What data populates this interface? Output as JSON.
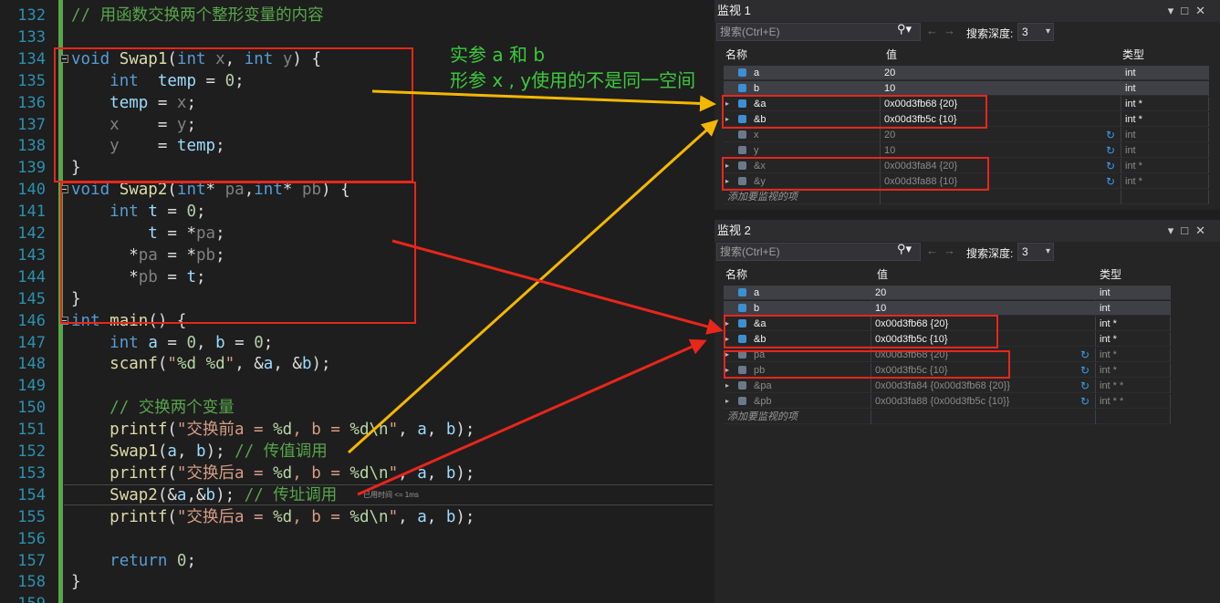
{
  "editor": {
    "lines": [
      {
        "n": "132",
        "t": "// 用函数交换两个整形变量的内容"
      },
      {
        "n": "133",
        "t": ""
      },
      {
        "n": "134",
        "t": "void Swap1(int x, int y) {"
      },
      {
        "n": "135",
        "t": "    int  temp = 0;"
      },
      {
        "n": "136",
        "t": "    temp = x;"
      },
      {
        "n": "137",
        "t": "    x    = y;"
      },
      {
        "n": "138",
        "t": "    y    = temp;"
      },
      {
        "n": "139",
        "t": "}"
      },
      {
        "n": "140",
        "t": "void Swap2(int* pa,int* pb) {"
      },
      {
        "n": "141",
        "t": "    int t = 0;"
      },
      {
        "n": "142",
        "t": "        t = *pa;"
      },
      {
        "n": "143",
        "t": "      *pa = *pb;"
      },
      {
        "n": "144",
        "t": "      *pb = t;"
      },
      {
        "n": "145",
        "t": "}"
      },
      {
        "n": "146",
        "t": "int main() {"
      },
      {
        "n": "147",
        "t": "    int a = 0, b = 0;"
      },
      {
        "n": "148",
        "t": "    scanf(\"%d %d\", &a, &b);"
      },
      {
        "n": "149",
        "t": ""
      },
      {
        "n": "150",
        "t": "    // 交换两个变量"
      },
      {
        "n": "151",
        "t": "    printf(\"交换前a = %d, b = %d\\n\", a, b);"
      },
      {
        "n": "152",
        "t": "    Swap1(a, b); // 传值调用"
      },
      {
        "n": "153",
        "t": "    printf(\"交换后a = %d, b = %d\\n\", a, b);"
      },
      {
        "n": "154",
        "t": "    Swap2(&a,&b); // 传址调用"
      },
      {
        "n": "155",
        "t": "    printf(\"交换后a = %d, b = %d\\n\", a, b);"
      },
      {
        "n": "156",
        "t": ""
      },
      {
        "n": "157",
        "t": "    return 0;"
      },
      {
        "n": "158",
        "t": "}"
      },
      {
        "n": "159",
        "t": ""
      }
    ],
    "perf_tip": "已用时间 <= 1ms"
  },
  "annotation": {
    "line1": "实参 a 和 b",
    "line2": "形参 x , y使用的不是同一空间"
  },
  "watch1": {
    "title": "监视 1",
    "search_placeholder": "搜索(Ctrl+E)",
    "depth_label": "搜索深度:",
    "depth_value": "3",
    "columns": {
      "name": "名称",
      "value": "值",
      "type": "类型"
    },
    "rows": [
      {
        "name": "a",
        "value": "20",
        "type": "int"
      },
      {
        "name": "b",
        "value": "10",
        "type": "int"
      },
      {
        "name": "&a",
        "value": "0x00d3fb68 {20}",
        "type": "int *"
      },
      {
        "name": "&b",
        "value": "0x00d3fb5c {10}",
        "type": "int *"
      },
      {
        "name": "x",
        "value": "20",
        "type": "int"
      },
      {
        "name": "y",
        "value": "10",
        "type": "int"
      },
      {
        "name": "&x",
        "value": "0x00d3fa84 {20}",
        "type": "int *"
      },
      {
        "name": "&y",
        "value": "0x00d3fa88 {10}",
        "type": "int *"
      }
    ],
    "add_row": "添加要监视的项"
  },
  "watch2": {
    "title": "监视 2",
    "search_placeholder": "搜索(Ctrl+E)",
    "depth_label": "搜索深度:",
    "depth_value": "3",
    "columns": {
      "name": "名称",
      "value": "值",
      "type": "类型"
    },
    "rows": [
      {
        "name": "a",
        "value": "20",
        "type": "int"
      },
      {
        "name": "b",
        "value": "10",
        "type": "int"
      },
      {
        "name": "&a",
        "value": "0x00d3fb68 {20}",
        "type": "int *"
      },
      {
        "name": "&b",
        "value": "0x00d3fb5c {10}",
        "type": "int *"
      },
      {
        "name": "pa",
        "value": "0x00d3fb68 {20}",
        "type": "int *"
      },
      {
        "name": "pb",
        "value": "0x00d3fb5c {10}",
        "type": "int *"
      },
      {
        "name": "&pa",
        "value": "0x00d3fa84 {0x00d3fb68 {20}}",
        "type": "int * *"
      },
      {
        "name": "&pb",
        "value": "0x00d3fa88 {0x00d3fb5c {10}}",
        "type": "int * *"
      }
    ],
    "add_row": "添加要监视的项"
  },
  "colors": {
    "box": "#e8261b",
    "arrow_yellow": "#f5b800",
    "arrow_red": "#e8261b",
    "annotation": "#3cc93c"
  }
}
